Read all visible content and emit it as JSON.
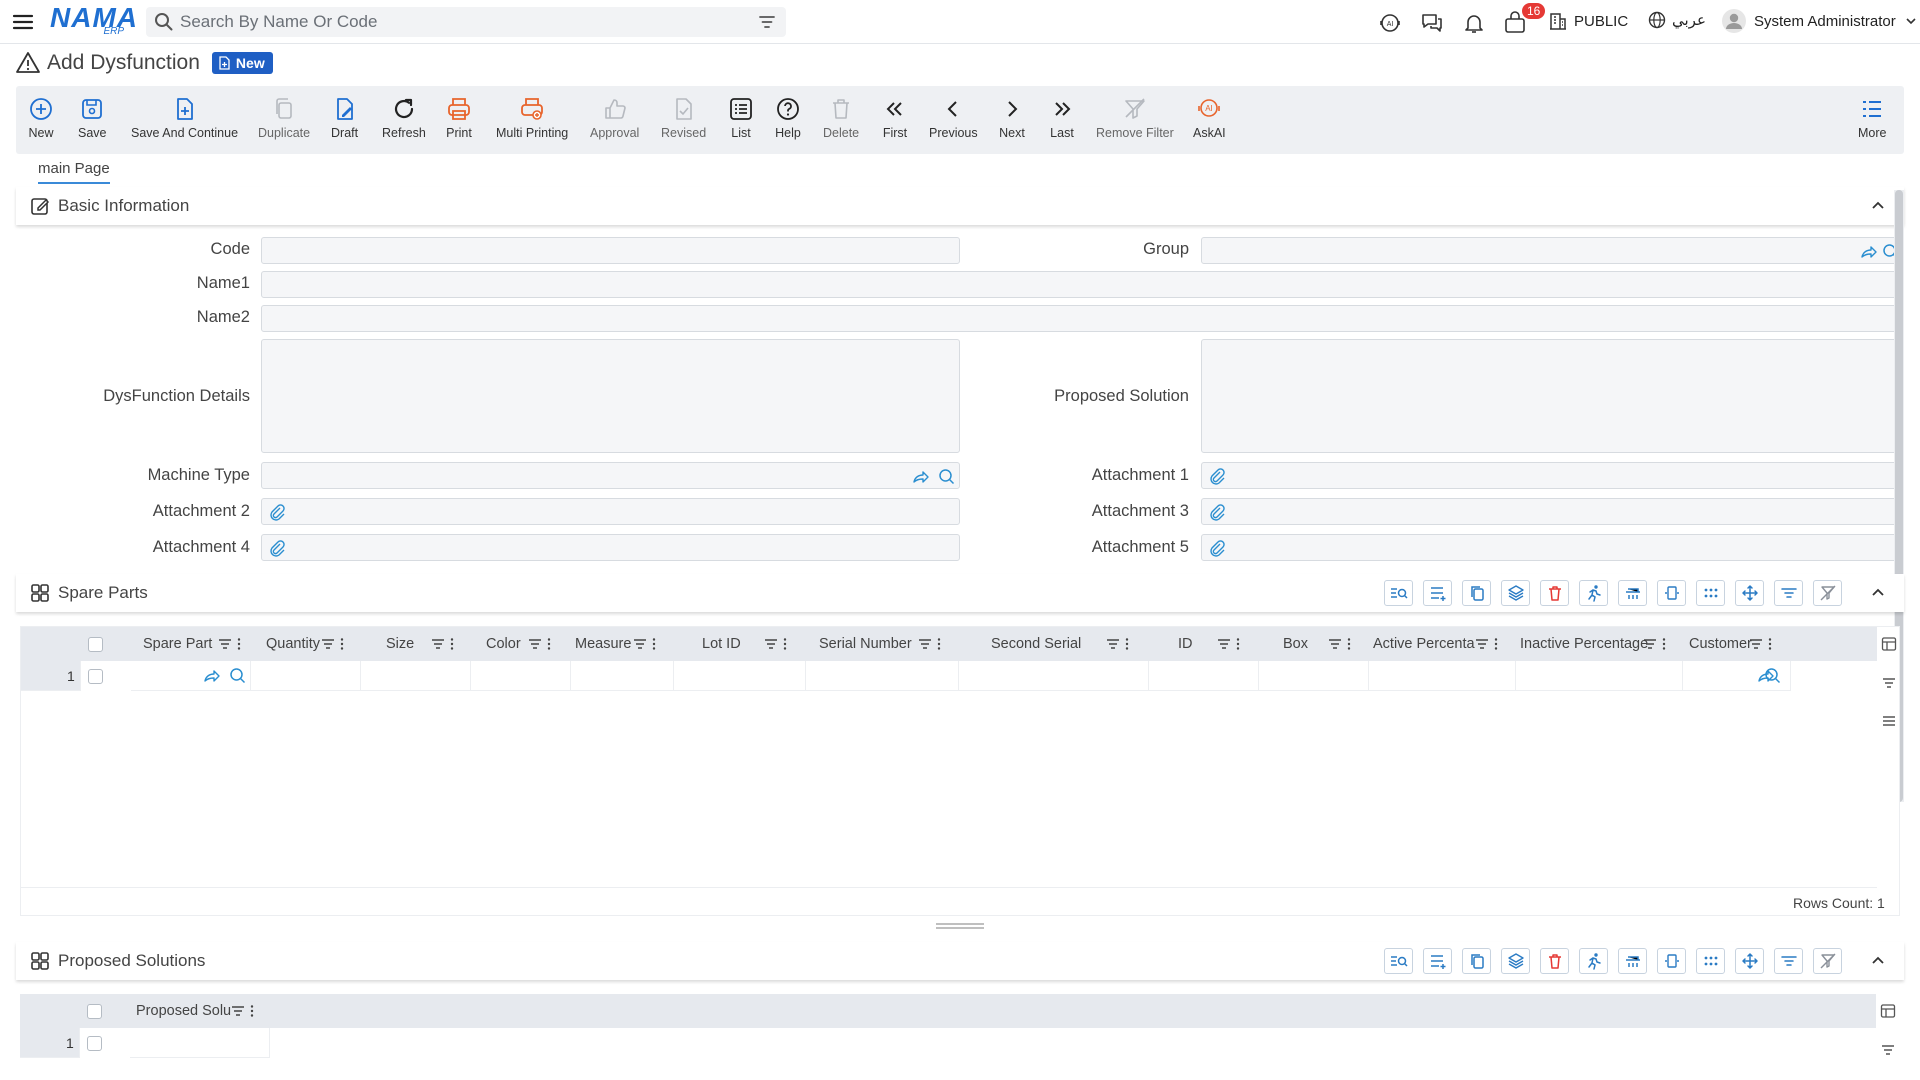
{
  "topbar": {
    "logo_text": "NAMA",
    "logo_sub": "ERP",
    "search_placeholder": "Search By Name Or Code",
    "notifications_badge": "16",
    "branch_label": "PUBLIC",
    "language_label": "عربي",
    "user_name": "System Administrator"
  },
  "page": {
    "title": "Add Dysfunction",
    "status_tag": "New"
  },
  "toolbar": {
    "new": "New",
    "save": "Save",
    "save_continue": "Save And Continue",
    "duplicate": "Duplicate",
    "draft": "Draft",
    "refresh": "Refresh",
    "print": "Print",
    "multi_printing": "Multi Printing",
    "approval": "Approval",
    "revised": "Revised",
    "list": "List",
    "help": "Help",
    "delete": "Delete",
    "first": "First",
    "previous": "Previous",
    "next": "Next",
    "last": "Last",
    "remove_filter": "Remove Filter",
    "askai": "AskAI",
    "more": "More"
  },
  "tabs": {
    "main": "main Page"
  },
  "basic_info": {
    "title": "Basic Information",
    "code": "Code",
    "group": "Group",
    "name1": "Name1",
    "name2": "Name2",
    "details": "DysFunction Details",
    "proposed_solution": "Proposed Solution",
    "machine_type": "Machine Type",
    "attachment1": "Attachment 1",
    "attachment2": "Attachment 2",
    "attachment3": "Attachment 3",
    "attachment4": "Attachment 4",
    "attachment5": "Attachment 5"
  },
  "spare_parts": {
    "title": "Spare Parts",
    "columns": [
      "Spare Part",
      "Quantity",
      "Size",
      "Color",
      "Measure",
      "Lot ID",
      "Serial Number",
      "Second Serial",
      "ID",
      "Box",
      "Active Percenta",
      "Inactive Percentage",
      "Customer"
    ],
    "row_number": "1",
    "rows_count": "Rows Count: 1"
  },
  "proposed_solutions": {
    "title": "Proposed Solutions",
    "columns": [
      "Proposed Solu"
    ],
    "row_number": "1"
  },
  "colors": {
    "accent": "#1f6fd1",
    "print_orange": "#e8642c",
    "badge_red": "#e53935",
    "tag_blue": "#1f5fc4"
  }
}
